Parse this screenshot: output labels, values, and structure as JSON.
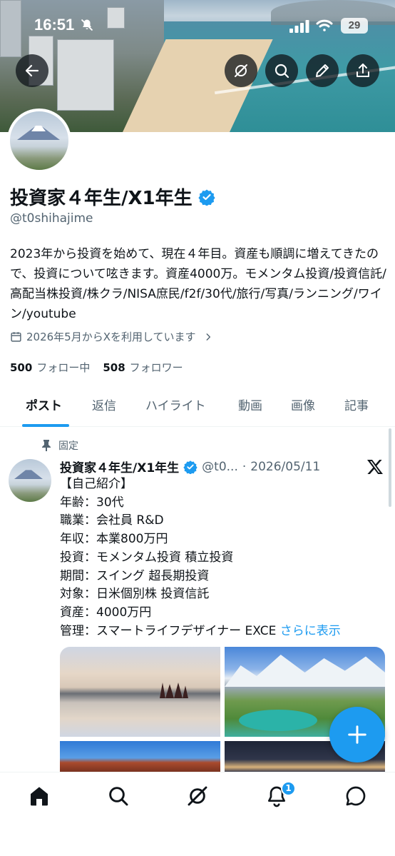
{
  "status_bar": {
    "time": "16:51",
    "battery": "29",
    "icons": [
      "bell-off-icon",
      "signal-icon",
      "wifi-icon",
      "battery-icon"
    ]
  },
  "header": {
    "buttons": [
      "back-arrow-icon",
      "grok-icon",
      "search-icon",
      "edit-pencil-icon",
      "share-icon"
    ]
  },
  "profile": {
    "name": "投資家４年生/X1年生",
    "handle": "@t0shihajime",
    "bio": "2023年から投資を始めて、現在４年目。資産も順調に増えてきたので、投資について呟きます。資産4000万。モメンタム投資/投資信託/高配当株投資/株クラ/NISA庶民/f2f/30代/旅行/写真/ランニング/ワイン/youtube",
    "joined": "2026年5月からXを利用しています",
    "following_count": "500",
    "following_label": "フォロー中",
    "followers_count": "508",
    "followers_label": "フォロワー"
  },
  "tabs": [
    {
      "label": "ポスト",
      "active": true
    },
    {
      "label": "返信",
      "active": false
    },
    {
      "label": "ハイライト",
      "active": false
    },
    {
      "label": "動画",
      "active": false
    },
    {
      "label": "画像",
      "active": false
    },
    {
      "label": "記事",
      "active": false
    }
  ],
  "pinned_post": {
    "pinned_label": "固定",
    "author_name": "投資家４年生/X1年生",
    "author_handle": "@t0...",
    "separator": "·",
    "date": "2026/05/11",
    "body": "【自己紹介】\n年齢：30代\n職業：会社員 R&D\n年収：本業800万円\n投資：モメンタム投資 積立投資\n期間：スイング 超長期投資\n対象：日米個別株 投資信託\n資産：4000万円\n管理：スマートライフデザイナー EXCE",
    "show_more": "さらに表示",
    "media_count": 4
  },
  "bottom_nav": {
    "items": [
      "home-icon",
      "search-icon",
      "grok-icon",
      "notifications-icon",
      "messages-icon"
    ],
    "notification_badge": "1"
  },
  "colors": {
    "accent": "#1d9bf0",
    "text": "#0f1419",
    "secondary_text": "#536471"
  }
}
